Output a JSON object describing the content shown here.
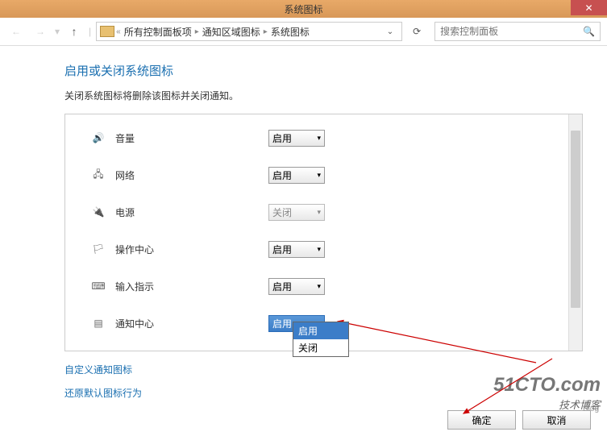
{
  "titleBar": {
    "title": "系统图标"
  },
  "breadcrumb": {
    "items": [
      "所有控制面板项",
      "通知区域图标",
      "系统图标"
    ]
  },
  "search": {
    "placeholder": "搜索控制面板"
  },
  "heading": "启用或关闭系统图标",
  "description": "关闭系统图标将删除该图标并关闭通知。",
  "options": {
    "on": "启用",
    "off": "关闭"
  },
  "rows": [
    {
      "label": "音量",
      "value": "启用",
      "disabled": false
    },
    {
      "label": "网络",
      "value": "启用",
      "disabled": false
    },
    {
      "label": "电源",
      "value": "关闭",
      "disabled": true
    },
    {
      "label": "操作中心",
      "value": "启用",
      "disabled": false
    },
    {
      "label": "输入指示",
      "value": "启用",
      "disabled": false
    },
    {
      "label": "通知中心",
      "value": "启用",
      "disabled": false,
      "open": true
    }
  ],
  "links": {
    "customize": "自定义通知图标",
    "restore": "还原默认图标行为"
  },
  "buttons": {
    "ok": "确定",
    "cancel": "取消"
  },
  "watermark": {
    "main": "51CTO.com",
    "sub": "技术博客",
    "blog": "Blog"
  }
}
